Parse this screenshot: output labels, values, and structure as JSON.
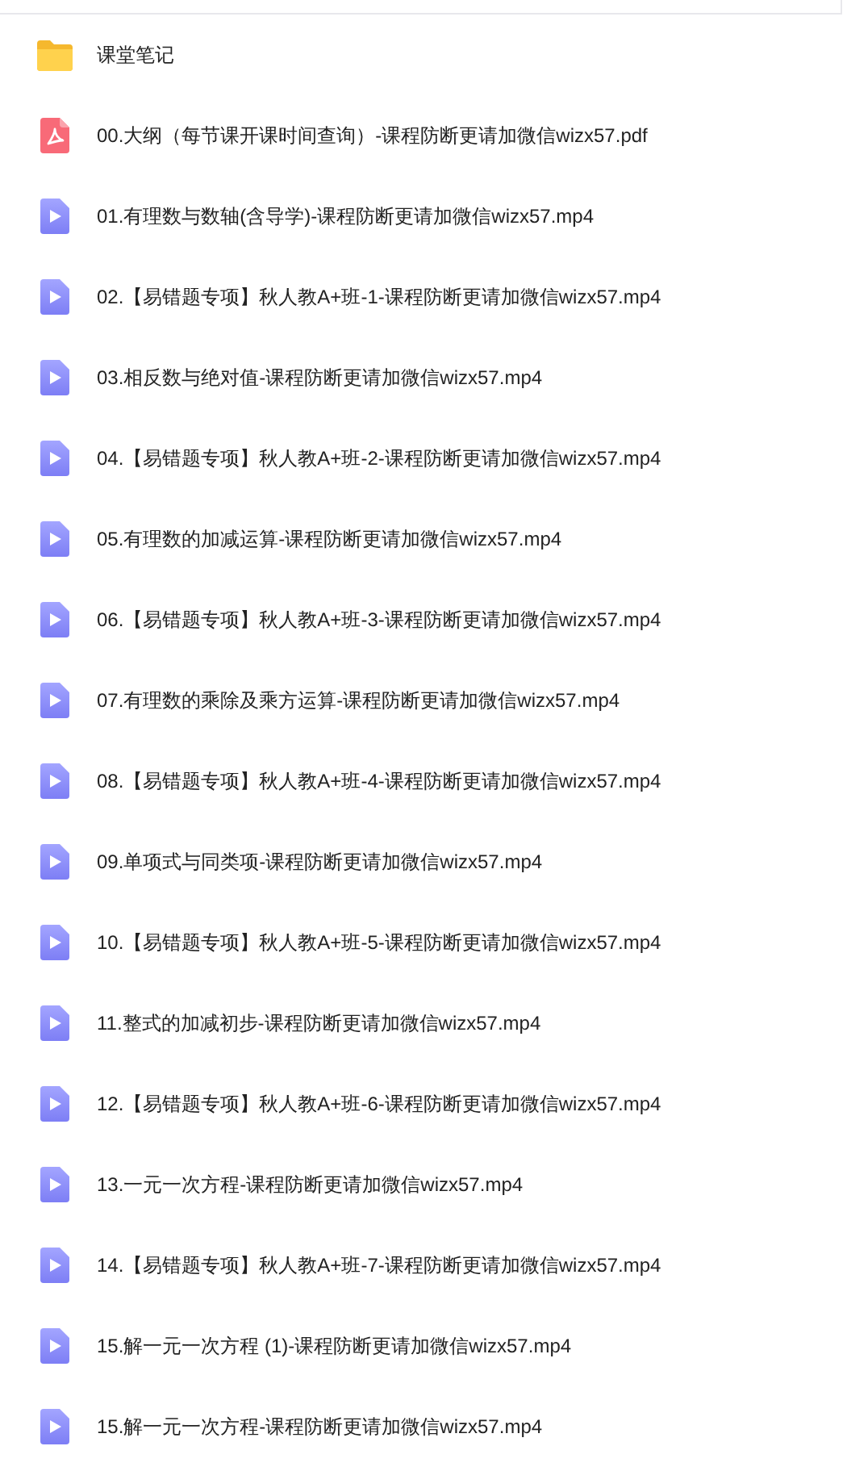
{
  "files": [
    {
      "kind": "folder",
      "name": "课堂笔记"
    },
    {
      "kind": "pdf",
      "name": "00.大纲（每节课开课时间查询）-课程防断更请加微信wizx57.pdf"
    },
    {
      "kind": "video",
      "name": "01.有理数与数轴(含导学)-课程防断更请加微信wizx57.mp4"
    },
    {
      "kind": "video",
      "name": "02.【易错题专项】秋人教A+班-1-课程防断更请加微信wizx57.mp4"
    },
    {
      "kind": "video",
      "name": "03.相反数与绝对值-课程防断更请加微信wizx57.mp4"
    },
    {
      "kind": "video",
      "name": "04.【易错题专项】秋人教A+班-2-课程防断更请加微信wizx57.mp4"
    },
    {
      "kind": "video",
      "name": "05.有理数的加减运算-课程防断更请加微信wizx57.mp4"
    },
    {
      "kind": "video",
      "name": "06.【易错题专项】秋人教A+班-3-课程防断更请加微信wizx57.mp4"
    },
    {
      "kind": "video",
      "name": "07.有理数的乘除及乘方运算-课程防断更请加微信wizx57.mp4"
    },
    {
      "kind": "video",
      "name": "08.【易错题专项】秋人教A+班-4-课程防断更请加微信wizx57.mp4"
    },
    {
      "kind": "video",
      "name": "09.单项式与同类项-课程防断更请加微信wizx57.mp4"
    },
    {
      "kind": "video",
      "name": "10.【易错题专项】秋人教A+班-5-课程防断更请加微信wizx57.mp4"
    },
    {
      "kind": "video",
      "name": "11.整式的加减初步-课程防断更请加微信wizx57.mp4"
    },
    {
      "kind": "video",
      "name": "12.【易错题专项】秋人教A+班-6-课程防断更请加微信wizx57.mp4"
    },
    {
      "kind": "video",
      "name": "13.一元一次方程-课程防断更请加微信wizx57.mp4"
    },
    {
      "kind": "video",
      "name": "14.【易错题专项】秋人教A+班-7-课程防断更请加微信wizx57.mp4"
    },
    {
      "kind": "video",
      "name": "15.解一元一次方程 (1)-课程防断更请加微信wizx57.mp4"
    },
    {
      "kind": "video",
      "name": "15.解一元一次方程-课程防断更请加微信wizx57.mp4"
    }
  ]
}
